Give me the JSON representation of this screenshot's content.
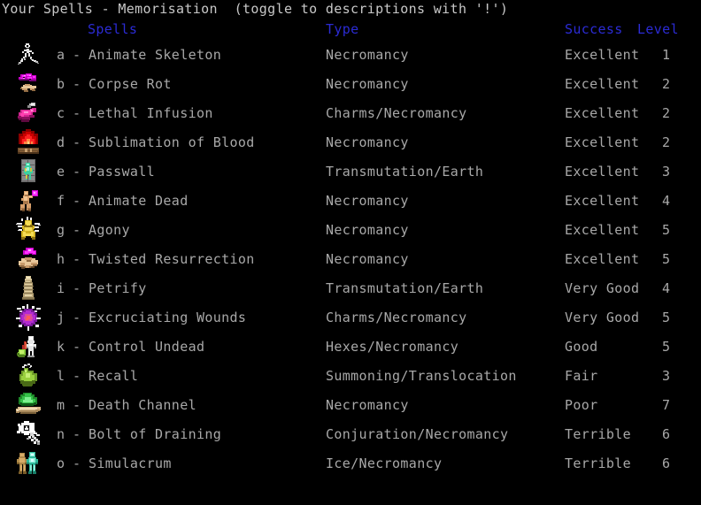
{
  "window": {
    "title": "Your Spells - Memorisation  (toggle to descriptions with '!')",
    "background_color": "#000000",
    "header_color": "#2b2bd4",
    "text_color": "#a8a8a8",
    "title_color": "#c8c8c8"
  },
  "columns": {
    "spells": "Spells",
    "type": "Type",
    "success": "Success",
    "level": "Level"
  },
  "rows": [
    {
      "letter": "a",
      "dash": "-",
      "name": "Animate Skeleton",
      "type": "Necromancy",
      "success": "Excellent",
      "level": "1",
      "icon": "animate-skeleton-icon"
    },
    {
      "letter": "b",
      "dash": "-",
      "name": "Corpse Rot",
      "type": "Necromancy",
      "success": "Excellent",
      "level": "2",
      "icon": "corpse-rot-icon"
    },
    {
      "letter": "c",
      "dash": "-",
      "name": "Lethal Infusion",
      "type": "Charms/Necromancy",
      "success": "Excellent",
      "level": "2",
      "icon": "lethal-infusion-icon"
    },
    {
      "letter": "d",
      "dash": "-",
      "name": "Sublimation of Blood",
      "type": "Necromancy",
      "success": "Excellent",
      "level": "2",
      "icon": "sublimation-of-blood-icon"
    },
    {
      "letter": "e",
      "dash": "-",
      "name": "Passwall",
      "type": "Transmutation/Earth",
      "success": "Excellent",
      "level": "3",
      "icon": "passwall-icon"
    },
    {
      "letter": "f",
      "dash": "-",
      "name": "Animate Dead",
      "type": "Necromancy",
      "success": "Excellent",
      "level": "4",
      "icon": "animate-dead-icon"
    },
    {
      "letter": "g",
      "dash": "-",
      "name": "Agony",
      "type": "Necromancy",
      "success": "Excellent",
      "level": "5",
      "icon": "agony-icon"
    },
    {
      "letter": "h",
      "dash": "-",
      "name": "Twisted Resurrection",
      "type": "Necromancy",
      "success": "Excellent",
      "level": "5",
      "icon": "twisted-resurrection-icon"
    },
    {
      "letter": "i",
      "dash": "-",
      "name": "Petrify",
      "type": "Transmutation/Earth",
      "success": "Very Good",
      "level": "4",
      "icon": "petrify-icon"
    },
    {
      "letter": "j",
      "dash": "-",
      "name": "Excruciating Wounds",
      "type": "Charms/Necromancy",
      "success": "Very Good",
      "level": "5",
      "icon": "excruciating-wounds-icon"
    },
    {
      "letter": "k",
      "dash": "-",
      "name": "Control Undead",
      "type": "Hexes/Necromancy",
      "success": "Good",
      "level": "5",
      "icon": "control-undead-icon"
    },
    {
      "letter": "l",
      "dash": "-",
      "name": "Recall",
      "type": "Summoning/Translocation",
      "success": "Fair",
      "level": "3",
      "icon": "recall-icon"
    },
    {
      "letter": "m",
      "dash": "-",
      "name": "Death Channel",
      "type": "Necromancy",
      "success": "Poor",
      "level": "7",
      "icon": "death-channel-icon"
    },
    {
      "letter": "n",
      "dash": "-",
      "name": "Bolt of Draining",
      "type": "Conjuration/Necromancy",
      "success": "Terrible",
      "level": "6",
      "icon": "bolt-of-draining-icon"
    },
    {
      "letter": "o",
      "dash": "-",
      "name": "Simulacrum",
      "type": "Ice/Necromancy",
      "success": "Terrible",
      "level": "6",
      "icon": "simulacrum-icon"
    }
  ]
}
